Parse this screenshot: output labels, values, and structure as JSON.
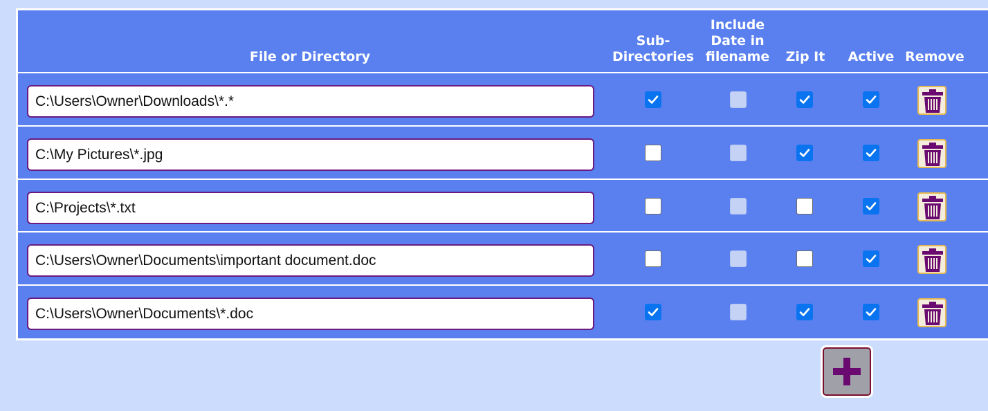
{
  "header": {
    "file_or_directory": "File or Directory",
    "sub_directories": "Sub-\nDirectories",
    "include_date": "Include\nDate in\nfilename",
    "zip_it": "Zip It",
    "active": "Active",
    "remove": "Remove"
  },
  "rows": [
    {
      "path": "C:\\Users\\Owner\\Downloads\\*.*",
      "sub_directories": true,
      "include_date": false,
      "zip_it": true,
      "active": true
    },
    {
      "path": "C:\\My Pictures\\*.jpg",
      "sub_directories": false,
      "include_date": false,
      "zip_it": true,
      "active": true
    },
    {
      "path": "C:\\Projects\\*.txt",
      "sub_directories": false,
      "include_date": false,
      "zip_it": false,
      "active": true
    },
    {
      "path": "C:\\Users\\Owner\\Documents\\important document.doc",
      "sub_directories": false,
      "include_date": false,
      "zip_it": false,
      "active": true
    },
    {
      "path": "C:\\Users\\Owner\\Documents\\*.doc",
      "sub_directories": true,
      "include_date": false,
      "zip_it": true,
      "active": true
    }
  ],
  "icons": {
    "remove": "trash-icon",
    "add": "plus-icon"
  },
  "colors": {
    "table_bg": "#5a80f0",
    "page_bg": "#ccdcfc",
    "checkbox_checked": "#0a74f0",
    "icon_purple": "#6a0a70"
  }
}
